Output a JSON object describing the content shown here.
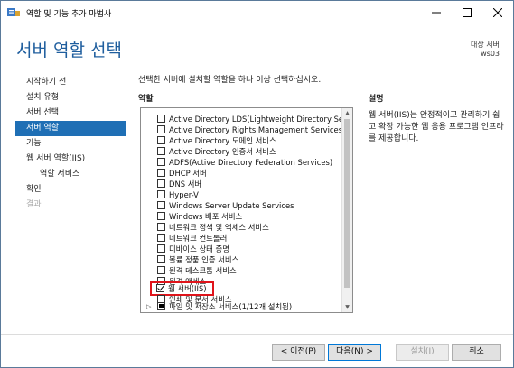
{
  "window": {
    "title": "역할 및 기능 추가 마법사",
    "controls": {
      "minimize": "—",
      "maximize": "☐",
      "close": "✕"
    }
  },
  "header": {
    "page_title": "서버 역할 선택",
    "target_label": "대상 서버",
    "target_name": "ws03"
  },
  "nav": {
    "items": [
      {
        "label": "시작하기 전",
        "state": "normal"
      },
      {
        "label": "설치 유형",
        "state": "normal"
      },
      {
        "label": "서버 선택",
        "state": "normal"
      },
      {
        "label": "서버 역할",
        "state": "active"
      },
      {
        "label": "기능",
        "state": "normal"
      },
      {
        "label": "웹 서버 역할(IIS)",
        "state": "normal"
      },
      {
        "label": "역할 서비스",
        "state": "sub"
      },
      {
        "label": "확인",
        "state": "normal"
      },
      {
        "label": "결과",
        "state": "disabled"
      }
    ]
  },
  "main": {
    "intro": "선택한 서버에 설치할 역할을 하나 이상 선택하십시오.",
    "roles_header": "역할",
    "roles": [
      {
        "label": "Active Directory LDS(Lightweight Directory Servic",
        "checked": false
      },
      {
        "label": "Active Directory Rights Management Services",
        "checked": false
      },
      {
        "label": "Active Directory 도메인 서비스",
        "checked": false
      },
      {
        "label": "Active Directory 인증서 서비스",
        "checked": false
      },
      {
        "label": "ADFS(Active Directory Federation Services)",
        "checked": false
      },
      {
        "label": "DHCP 서버",
        "checked": false
      },
      {
        "label": "DNS 서버",
        "checked": false
      },
      {
        "label": "Hyper-V",
        "checked": false
      },
      {
        "label": "Windows Server Update Services",
        "checked": false
      },
      {
        "label": "Windows 배포 서비스",
        "checked": false
      },
      {
        "label": "네트워크 정책 및 액세스 서비스",
        "checked": false
      },
      {
        "label": "네트워크 컨트롤러",
        "checked": false
      },
      {
        "label": "디바이스 상태 증명",
        "checked": false
      },
      {
        "label": "볼륨 정품 인증 서비스",
        "checked": false
      },
      {
        "label": "원격 데스크톱 서비스",
        "checked": false
      },
      {
        "label": "원격 액세스",
        "checked": false
      },
      {
        "label": "웹 서버(IIS)",
        "checked": true,
        "highlighted": true
      },
      {
        "label": "인쇄 및 문서 서비스",
        "checked": false
      },
      {
        "label": "파일 및 저장소 서비스(1/12개 설치됨)",
        "checked": "partial",
        "expandable": true
      }
    ],
    "description_header": "설명",
    "description": "웹 서버(IIS)는 안정적이고 관리하기 쉽고 확장 가능한 웹 응용 프로그램 인프라를 제공합니다."
  },
  "footer": {
    "prev": "< 이전(P)",
    "next": "다음(N) >",
    "install": "설치(I)",
    "cancel": "취소"
  },
  "colors": {
    "accent": "#1f6fb5",
    "title_blue": "#1f5e9e",
    "highlight_red": "#e0141b"
  }
}
